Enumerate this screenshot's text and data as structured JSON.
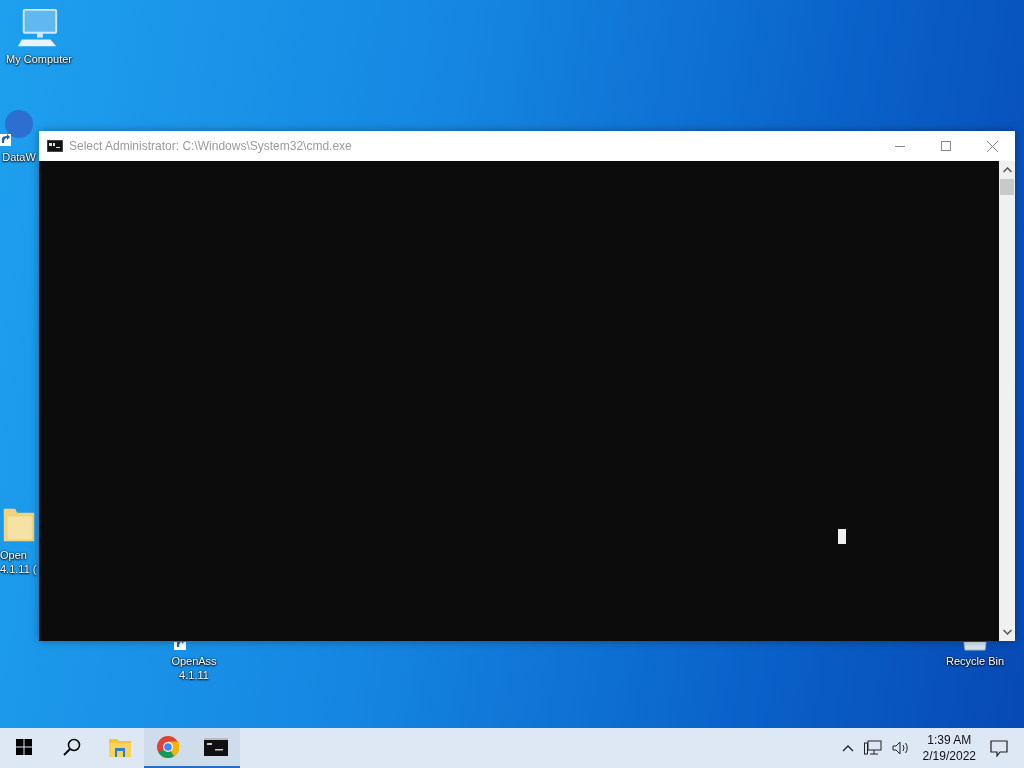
{
  "desktop_icons": [
    {
      "kind": "computer",
      "lines": [
        "My Computer"
      ]
    },
    {
      "kind": "app",
      "lines": [
        "DataW"
      ]
    },
    {
      "kind": "folder",
      "lines": [
        "Open",
        "4.1.11 ("
      ]
    },
    {
      "kind": "app",
      "lines": [
        "OpenAss",
        "4.1.11"
      ]
    },
    {
      "kind": "bin",
      "lines": [
        "Recycle Bin"
      ]
    }
  ],
  "window": {
    "title": "Select Administrator: C:\\Windows\\System32\\cmd.exe",
    "cursor_visible": true
  },
  "taskbar": {
    "apps": [
      {
        "kind": "start",
        "running": false
      },
      {
        "kind": "search",
        "running": false
      },
      {
        "kind": "explorer",
        "running": false
      },
      {
        "kind": "browser",
        "running": true
      },
      {
        "kind": "console",
        "running": true
      }
    ],
    "time": "1:39 AM",
    "date": "2/19/2022"
  }
}
